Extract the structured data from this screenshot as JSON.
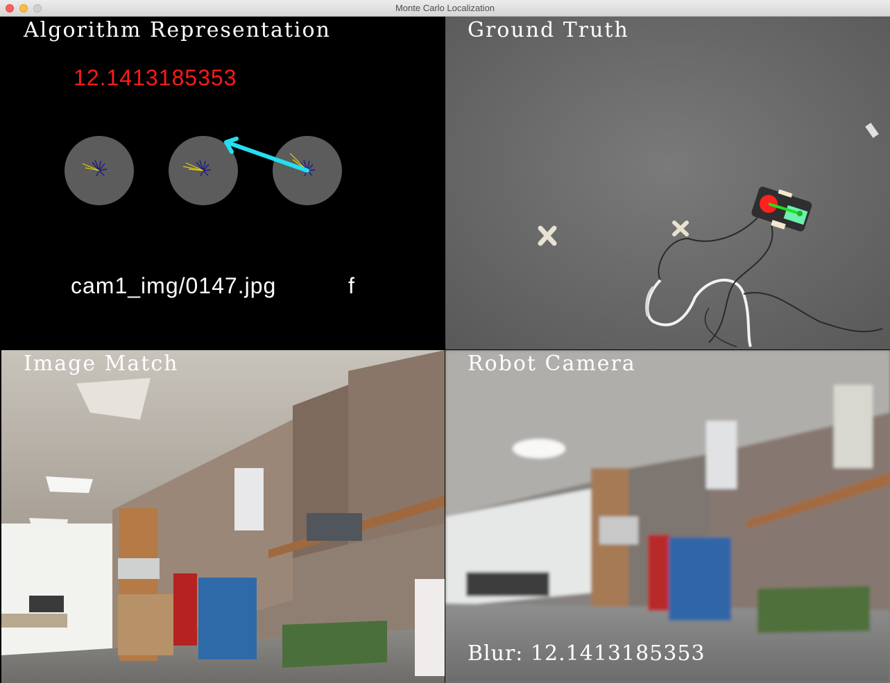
{
  "window": {
    "title": "Monte Carlo Localization"
  },
  "panes": {
    "algorithm": {
      "label": "Algorithm Representation",
      "blur_score": "12.1413185353",
      "image_path": "cam1_img/0147.jpg",
      "flag": "f"
    },
    "ground_truth": {
      "label": "Ground Truth"
    },
    "image_match": {
      "label": "Image Match"
    },
    "robot_camera": {
      "label": "Robot Camera",
      "blur_caption": "Blur: 12.1413185353"
    }
  },
  "colors": {
    "blur_score": "#ff1a1a",
    "best_match_arrow": "#22e0f0",
    "particle_disc": "#5c5c5c",
    "particles": "#1a1a8a",
    "particle_heading": "#e6d000",
    "robot_marker": "#ff2020",
    "robot_heading": "#20e020"
  },
  "icons": {
    "close": "close-window-icon",
    "minimize": "minimize-window-icon",
    "zoom": "zoom-window-icon"
  }
}
